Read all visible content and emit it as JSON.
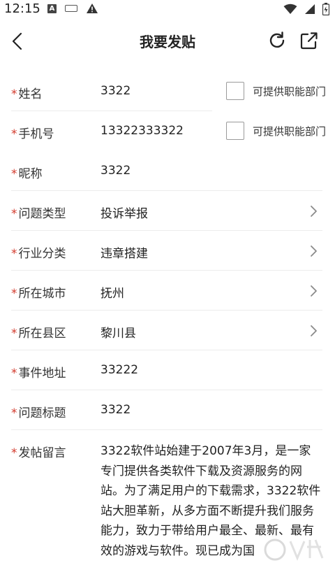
{
  "status_bar": {
    "time": "12:15",
    "icons_left": [
      "a-notification-icon",
      "keyboard-icon",
      "warning-icon"
    ],
    "icons_right": [
      "wifi-icon",
      "signal-icon",
      "battery-icon"
    ]
  },
  "app_bar": {
    "title": "我要发贴",
    "back_icon": "chevron-left-icon",
    "refresh_icon": "refresh-icon",
    "share_icon": "share-icon"
  },
  "form": {
    "required_mark": "*",
    "name": {
      "label": "姓名",
      "value": "3322",
      "checkbox_label": "可提供职能部门"
    },
    "phone": {
      "label": "手机号",
      "value": "13322333322",
      "checkbox_label": "可提供职能部门"
    },
    "nickname": {
      "label": "昵称",
      "value": "3322"
    },
    "issue_type": {
      "label": "问题类型",
      "value": "投诉举报"
    },
    "industry": {
      "label": "行业分类",
      "value": "违章搭建"
    },
    "city": {
      "label": "所在城市",
      "value": "抚州"
    },
    "district": {
      "label": "所在县区",
      "value": "黎川县"
    },
    "address": {
      "label": "事件地址",
      "value": "33222"
    },
    "subject": {
      "label": "问题标题",
      "value": "3322"
    },
    "message": {
      "label": "发帖留言",
      "value": "3322软件站始建于2007年3月，是一家专门提供各类软件下载及资源服务的网站。为了满足用户的下载需求，3322软件站大胆革新，从多方面不断提升我们服务能力，致力于带给用户最全、最新、最有效的游戏与软件。现已成为国"
    }
  },
  "colors": {
    "required": "#d33a2c",
    "divider": "#ececec",
    "text": "#222222"
  }
}
